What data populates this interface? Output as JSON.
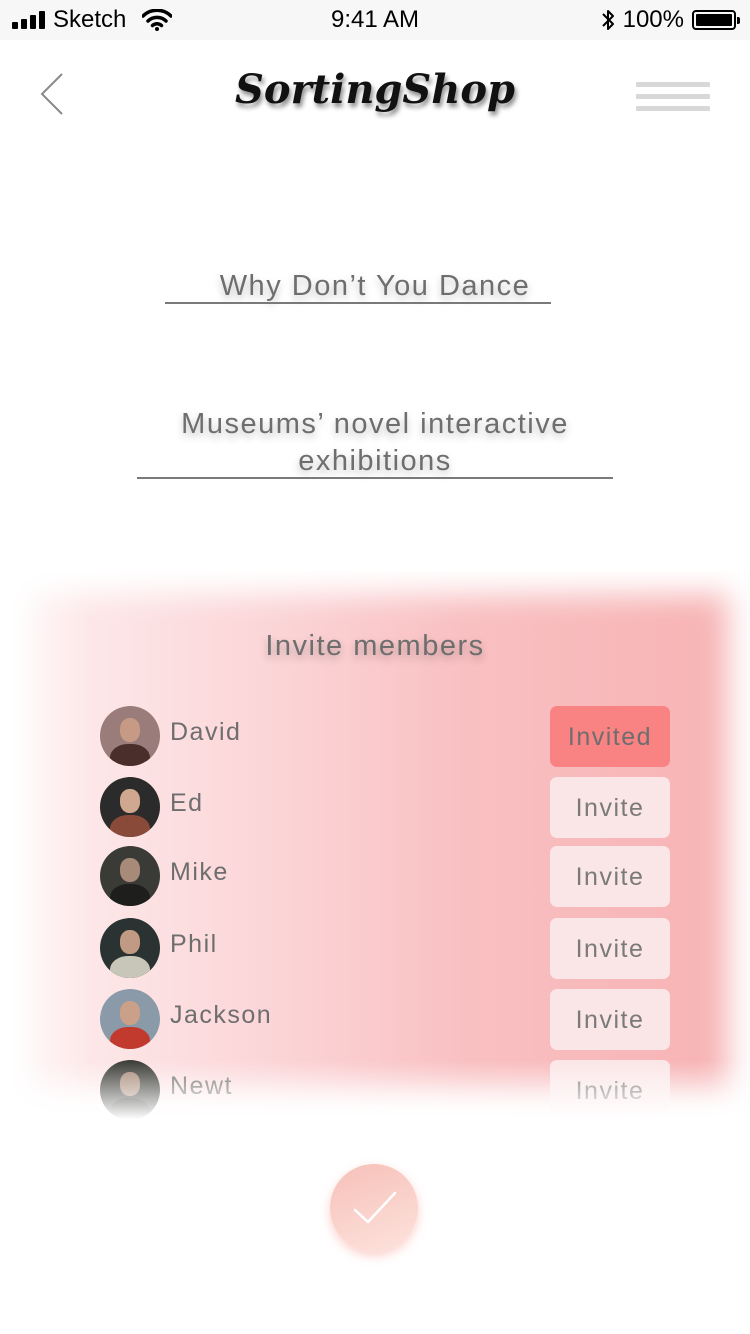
{
  "status_bar": {
    "carrier": "Sketch",
    "time": "9:41 AM",
    "battery": "100%",
    "icons": [
      "signal-bars-icon",
      "wifi-icon",
      "bluetooth-icon",
      "battery-icon"
    ]
  },
  "header": {
    "brand": "SortingShop",
    "back_icon": "chevron-left-icon",
    "menu_icon": "hamburger-menu-icon"
  },
  "fields": [
    {
      "text": "Why Don’t You Dance"
    },
    {
      "line1": "Museums’ novel interactive",
      "line2": "exhibitions"
    }
  ],
  "invite": {
    "title": "Invite members",
    "members": [
      {
        "name": "David",
        "button": "Invited",
        "invited": true
      },
      {
        "name": "Ed",
        "button": "Invite",
        "invited": false
      },
      {
        "name": "Mike",
        "button": "Invite",
        "invited": false
      },
      {
        "name": "Phil",
        "button": "Invite",
        "invited": false
      },
      {
        "name": "Jackson",
        "button": "Invite",
        "invited": false
      },
      {
        "name": "Newt",
        "button": "Invite",
        "invited": false
      }
    ]
  },
  "confirm": {
    "icon": "checkmark-icon"
  },
  "colors": {
    "invited_bg": "#f98283",
    "invite_bg": "#fbe6e7",
    "panel_gradient_end": "#f7b2b3",
    "text_gray": "#6e6e6e"
  }
}
